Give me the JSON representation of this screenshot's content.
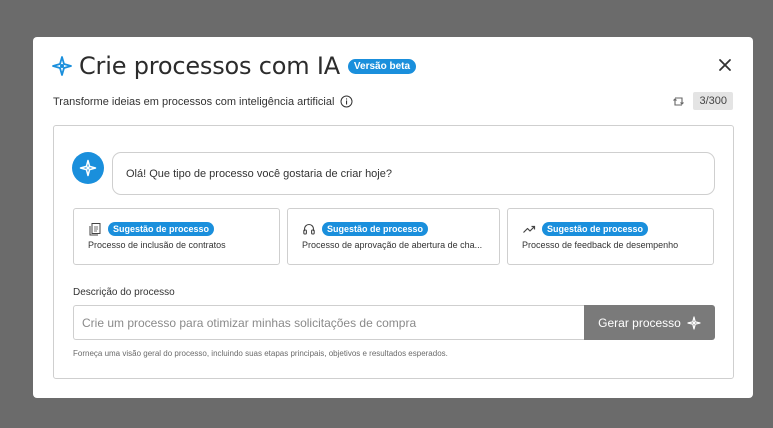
{
  "modal": {
    "title": "Crie processos com IA",
    "beta_badge": "Versão beta",
    "subtitle": "Transforme ideias em processos com inteligência artificial",
    "counter": "3/300"
  },
  "chat": {
    "greeting": "Olá! Que tipo de processo você gostaria de criar hoje?"
  },
  "suggestions": [
    {
      "badge": "Sugestão de processo",
      "text": "Processo de inclusão de contratos",
      "icon": "document-copy-icon"
    },
    {
      "badge": "Sugestão de processo",
      "text": "Processo de aprovação de abertura de cha...",
      "icon": "headphones-icon"
    },
    {
      "badge": "Sugestão de processo",
      "text": "Processo de feedback de desempenho",
      "icon": "trend-up-icon"
    }
  ],
  "form": {
    "label": "Descrição do processo",
    "placeholder": "Crie um processo para otimizar minhas solicitações de compra",
    "button": "Gerar processo",
    "hint": "Forneça uma visão geral do processo, incluindo suas etapas principais, objetivos e resultados esperados."
  },
  "colors": {
    "overlay": "#6b6b6b",
    "accent": "#1a8fdc",
    "button": "#7a7a7a"
  }
}
